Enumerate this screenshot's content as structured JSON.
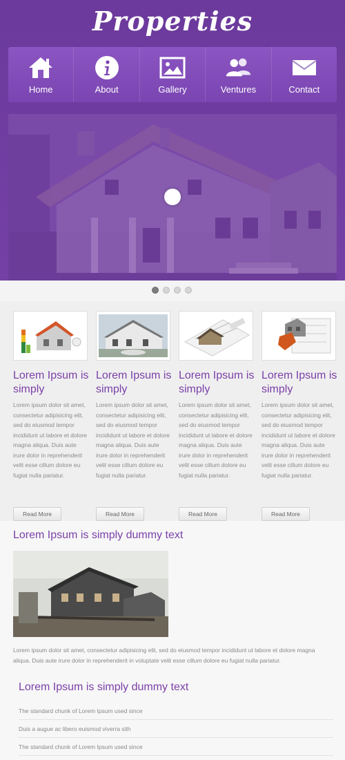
{
  "header": {
    "logo": "Properties"
  },
  "nav": [
    {
      "label": "Home",
      "icon": "home-icon"
    },
    {
      "label": "About",
      "icon": "info-icon"
    },
    {
      "label": "Gallery",
      "icon": "picture-icon"
    },
    {
      "label": "Ventures",
      "icon": "users-icon"
    },
    {
      "label": "Contact",
      "icon": "mail-icon"
    }
  ],
  "slider": {
    "slides": 4,
    "active": 1
  },
  "features": [
    {
      "title": "Lorem Ipsum is simply",
      "text": "Lorem ipsum dolor sit amet, consectetur adipisicing elit, sed do eiusmod tempor incididunt ut labore et dolore magna aliqua. Duis aute irure dolor in reprehenderit velit esse cillum dolore eu fugiat nulla pariatur.",
      "button": "Read More"
    },
    {
      "title": "Lorem Ipsum is simply",
      "text": "Lorem ipsum dolor sit amet, consectetur adipisicing elit, sed do eiusmod tempor incididunt ut labore et dolore magna aliqua. Duis aute irure dolor in reprehenderit velit esse cillum dolore eu fugiat nulla pariatur.",
      "button": "Read More"
    },
    {
      "title": "Lorem Ipsum is simply",
      "text": "Lorem ipsum dolor sit amet, consectetur adipisicing elit, sed do eiusmod tempor incididunt ut labore et dolore magna aliqua. Duis aute irure dolor in reprehenderit velit esse cillum dolore eu fugiat nulla pariatur.",
      "button": "Read More"
    },
    {
      "title": "Lorem Ipsum is simply",
      "text": "Lorem ipsum dolor sit amet, consectetur adipisicing elit, sed do eiusmod tempor incididunt ut labore et dolore magna aliqua. Duis aute irure dolor in reprehenderit velit esse cillum dolore eu fugiat nulla pariatur.",
      "button": "Read More"
    }
  ],
  "about": {
    "title": "Lorem Ipsum is simply dummy text",
    "text": "Lorem ipsum dolor sit amet, consectetur adipisicing elit, sed do eiusmod tempor incididunt ut labore et dolore magna aliqua. Duis aute irure dolor in reprehenderit in voluptate velit esse cillum dolore eu fugiat nulla pariatur."
  },
  "list": {
    "title": "Lorem Ipsum is simply dummy text",
    "items": [
      "The standard chunk of Lorem Ipsum used since",
      "Duis a augue ac libero euismod viverra sith",
      "The standard chunk of Lorem Ipsum used since"
    ]
  },
  "colors": {
    "brand_purple": "#7440a6",
    "accent_text": "#7a3fa8"
  }
}
